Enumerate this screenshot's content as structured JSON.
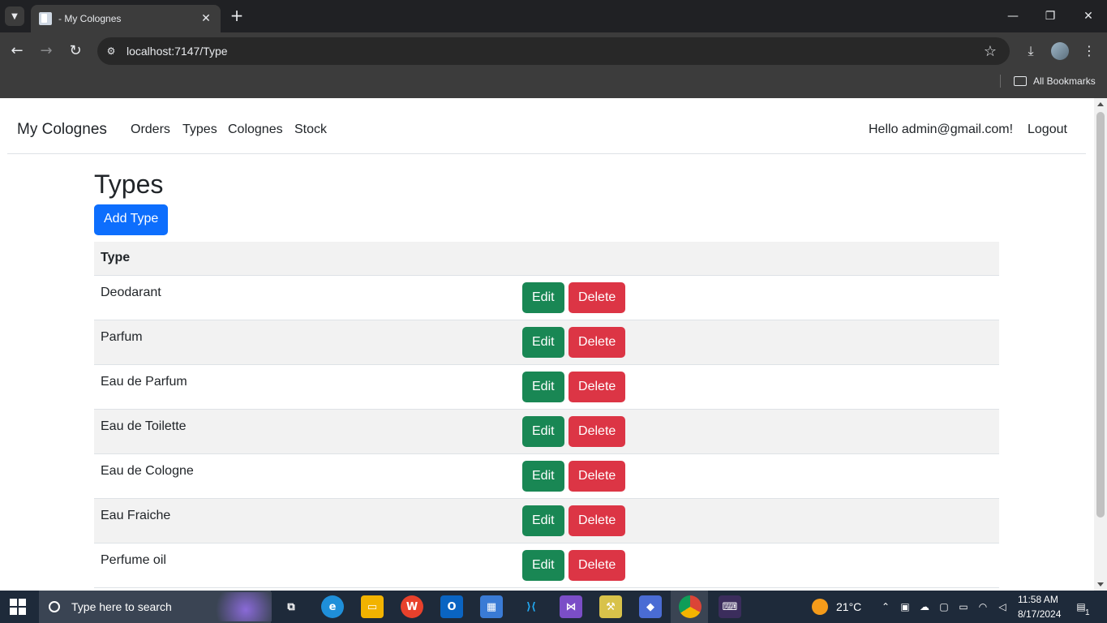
{
  "browser": {
    "tab_title": "- My Colognes",
    "url": "localhost:7147/Type",
    "all_bookmarks": "All Bookmarks"
  },
  "navbar": {
    "brand": "My Colognes",
    "links": [
      "Orders",
      "Types",
      "Colognes",
      "Stock"
    ],
    "greeting": "Hello admin@gmail.com!",
    "logout": "Logout"
  },
  "page": {
    "title": "Types",
    "add_button": "Add Type",
    "table": {
      "header": "Type",
      "edit_label": "Edit",
      "delete_label": "Delete",
      "rows": [
        "Deodarant",
        "Parfum",
        "Eau de Parfum",
        "Eau de Toilette",
        "Eau de Cologne",
        "Eau Fraiche",
        "Perfume oil"
      ]
    }
  },
  "taskbar": {
    "search_placeholder": "Type here to search",
    "weather": "21°C",
    "time": "11:58 AM",
    "date": "8/17/2024",
    "notification_count": "1"
  },
  "colors": {
    "primary": "#0d6efd",
    "edit": "#198754",
    "delete": "#dc3545"
  }
}
